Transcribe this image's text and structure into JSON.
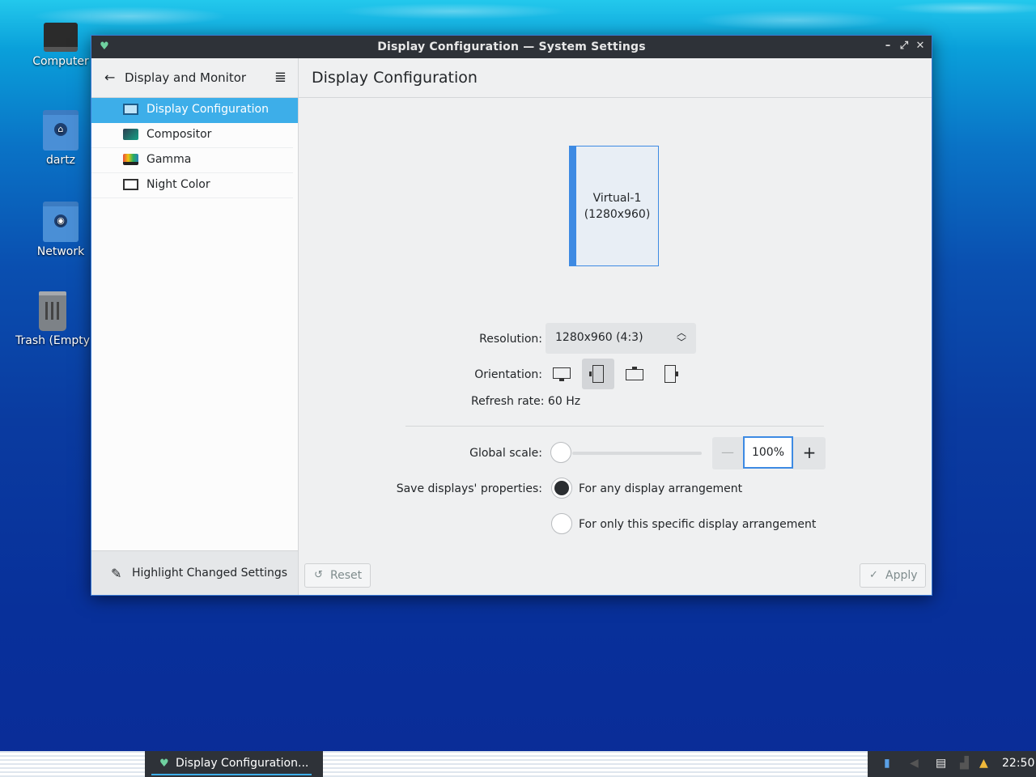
{
  "desktop": {
    "icons": [
      {
        "label": "Computer",
        "icon": "computer-icon"
      },
      {
        "label": "dartz",
        "icon": "home-folder-icon"
      },
      {
        "label": "Network",
        "icon": "network-folder-icon"
      },
      {
        "label": "Trash (Empty)",
        "icon": "trash-icon"
      }
    ]
  },
  "window": {
    "title": "Display Configuration  — System Settings",
    "controls": [
      "minimize",
      "maximize",
      "close"
    ]
  },
  "sidebar": {
    "header": "Display and Monitor",
    "items": [
      {
        "label": "Display Configuration",
        "icon": "display-icon",
        "active": true
      },
      {
        "label": "Compositor",
        "icon": "compositor-icon",
        "active": false
      },
      {
        "label": "Gamma",
        "icon": "gamma-icon",
        "active": false
      },
      {
        "label": "Night Color",
        "icon": "night-color-icon",
        "active": false
      }
    ],
    "footer": "Highlight Changed Settings"
  },
  "main": {
    "title": "Display Configuration",
    "output": {
      "name": "Virtual-1",
      "resolution": "(1280x960)"
    },
    "resolution_label": "Resolution:",
    "resolution_value": "1280x960 (4:3)",
    "orientation_label": "Orientation:",
    "orientation_options": [
      "landscape",
      "portrait",
      "landscape-flipped",
      "portrait-flipped"
    ],
    "orientation_selected": "portrait",
    "refresh_rate": "Refresh rate: 60 Hz",
    "global_scale_label": "Global scale:",
    "global_scale_value": "100%",
    "save_label": "Save displays' properties:",
    "save_options": [
      {
        "label": "For any display arrangement",
        "checked": true
      },
      {
        "label": "For only this specific display arrangement",
        "checked": false
      }
    ],
    "reset_label": "Reset",
    "apply_label": "Apply"
  },
  "taskbar": {
    "task_label": "Display Configuration...",
    "clock": "22:50"
  },
  "colors": {
    "accent": "#3daee9",
    "titlebar": "#2e3238",
    "focus": "#3d8ae3"
  }
}
